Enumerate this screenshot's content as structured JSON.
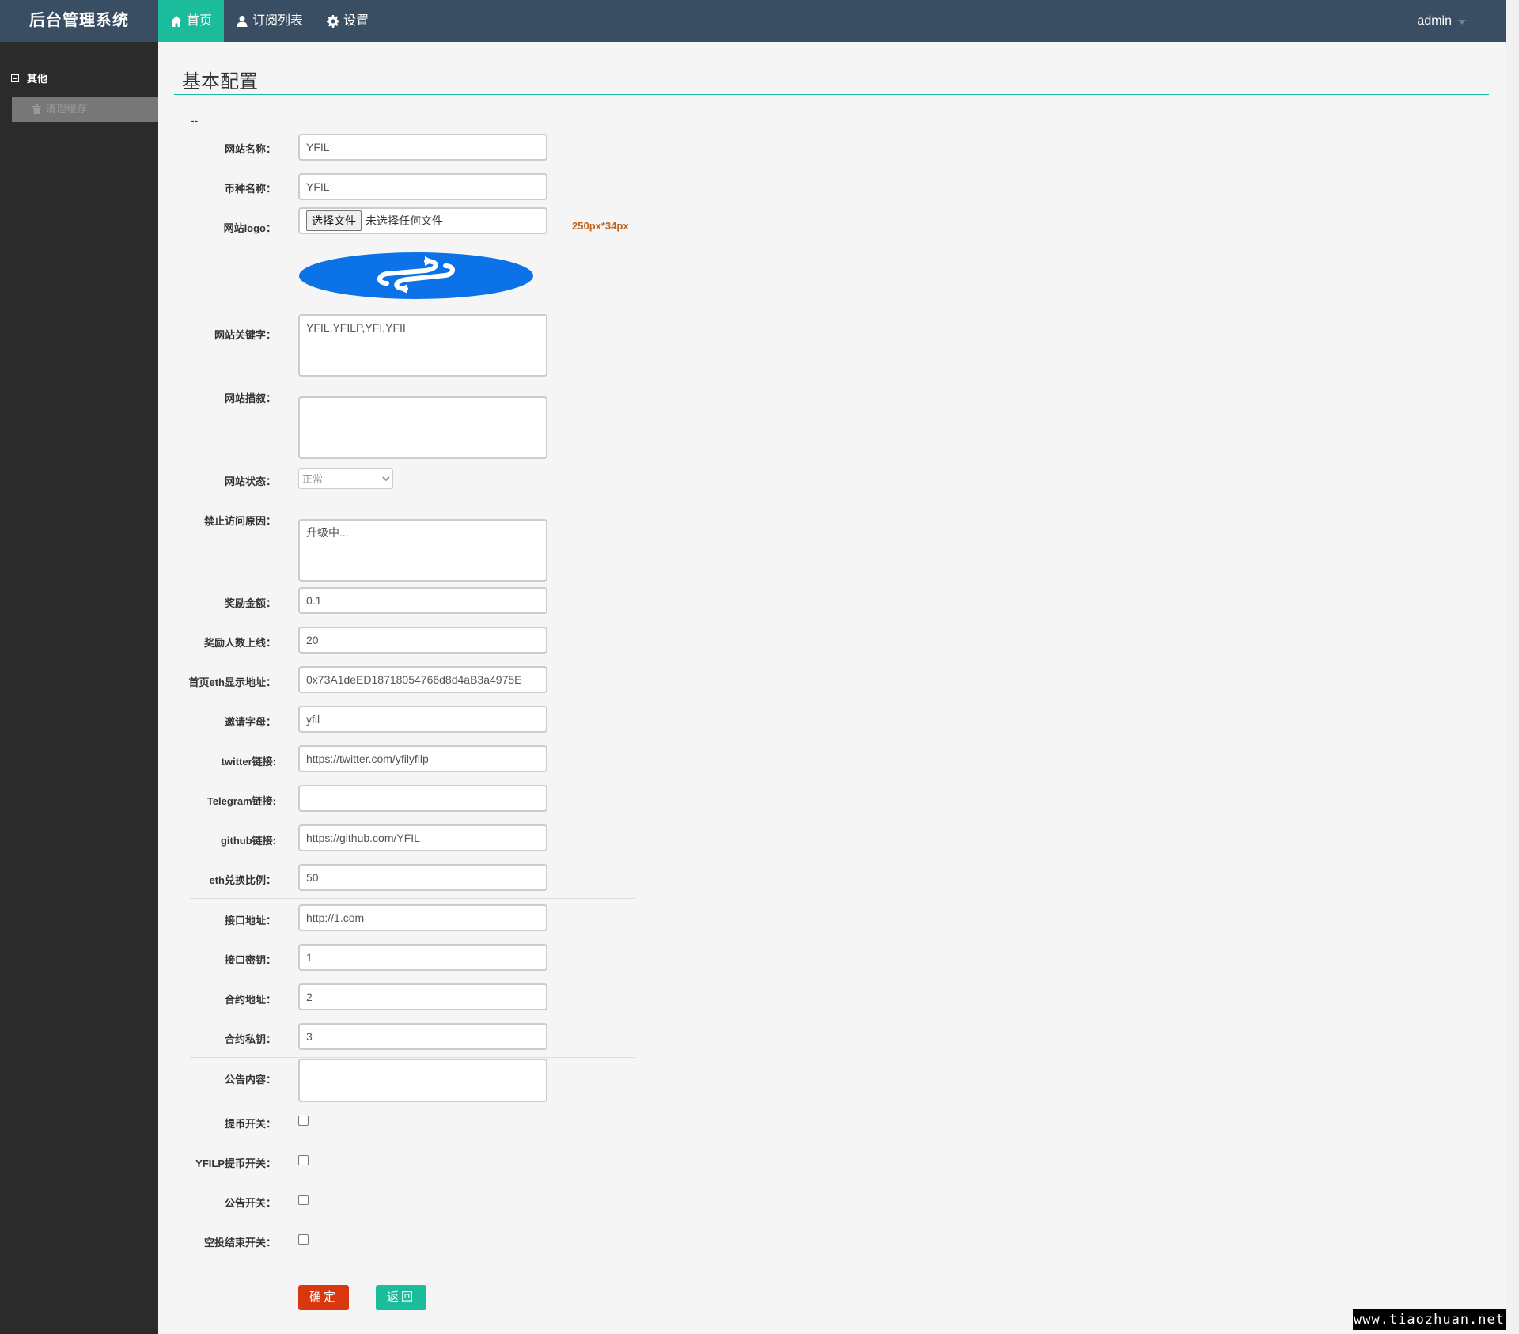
{
  "brand": "后台管理系统",
  "nav": [
    {
      "label": "首页",
      "icon": "home-icon",
      "active": true
    },
    {
      "label": "订阅列表",
      "icon": "user-icon",
      "active": false
    },
    {
      "label": "设置",
      "icon": "gear-icon",
      "active": false
    }
  ],
  "user": "admin",
  "sidebar": {
    "group": "其他",
    "items": [
      {
        "label": "清理缓存",
        "icon": "trash-icon"
      }
    ]
  },
  "page": {
    "title": "基本配置",
    "dash": "--"
  },
  "form": {
    "site_name": {
      "label": "网站名称：",
      "value": "YFIL"
    },
    "coin_name": {
      "label": "币种名称：",
      "value": "YFIL"
    },
    "logo": {
      "label": "网站logo：",
      "button": "选择文件",
      "status": "未选择任何文件",
      "hint": "250px*34px"
    },
    "keywords": {
      "label": "网站关键字：",
      "value": "YFIL,YFILP,YFI,YFII"
    },
    "description": {
      "label": "网站描叙：",
      "value": ""
    },
    "status": {
      "label": "网站状态：",
      "value": "正常"
    },
    "ban_reason": {
      "label": "禁止访问原因：",
      "value": "升级中..."
    },
    "reward_amount": {
      "label": "奖励金额：",
      "value": "0.1"
    },
    "reward_limit": {
      "label": "奖励人数上线：",
      "value": "20"
    },
    "eth_address": {
      "label": "首页eth显示地址：",
      "value": "0x73A1deED18718054766d8d4aB3a4975E"
    },
    "invite_letter": {
      "label": "邀请字母：",
      "value": "yfil"
    },
    "twitter": {
      "label": "twitter链接:",
      "value": "https://twitter.com/yfilyfilp"
    },
    "telegram": {
      "label": "Telegram链接:",
      "value": ""
    },
    "github": {
      "label": "github链接:",
      "value": "https://github.com/YFIL"
    },
    "eth_ratio": {
      "label": "eth兑换比例：",
      "value": "50"
    },
    "api_url": {
      "label": "接口地址：",
      "value": "http://1.com"
    },
    "api_key": {
      "label": "接口密钥：",
      "value": "1"
    },
    "contract_address": {
      "label": "合约地址：",
      "value": "2"
    },
    "contract_key": {
      "label": "合约私钥：",
      "value": "3"
    },
    "notice": {
      "label": "公告内容：",
      "value": ""
    },
    "withdraw_switch": {
      "label": "提币开关：",
      "checked": false
    },
    "yfilp_withdraw_switch": {
      "label": "YFILP提币开关：",
      "checked": false
    },
    "notice_switch": {
      "label": "公告开关：",
      "checked": false
    },
    "airdrop_end_switch": {
      "label": "空投结束开关：",
      "checked": false
    },
    "submit": "确定",
    "back": "返回"
  },
  "watermark": "www.tiaozhuan.net",
  "colors": {
    "topbar": "#394d63",
    "accent": "#1abc9c",
    "sidebar": "#2b2b2b",
    "danger": "#d9380e",
    "hint": "#c0641c",
    "logo_blue": "#0b72e8"
  }
}
